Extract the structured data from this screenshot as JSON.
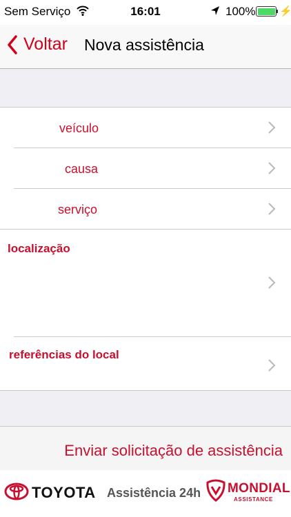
{
  "status_bar": {
    "carrier": "Sem Serviço",
    "time": "16:01",
    "battery": "100%"
  },
  "nav": {
    "back_label": "Voltar",
    "title": "Nova assistência"
  },
  "form": {
    "rows": [
      {
        "label": "veículo"
      },
      {
        "label": "causa"
      },
      {
        "label": "serviço"
      },
      {
        "label": "localização"
      },
      {
        "label": "referências do local"
      }
    ]
  },
  "actions": {
    "submit_label": "Enviar solicitação de assistência"
  },
  "brand": {
    "toyota": "TOYOTA",
    "assist": "Assistência 24h",
    "mondial": "MONDIAL",
    "mondial_sub": "ASSISTANCE"
  },
  "colors": {
    "accent": "#c8102e",
    "battery": "#4cd964"
  }
}
